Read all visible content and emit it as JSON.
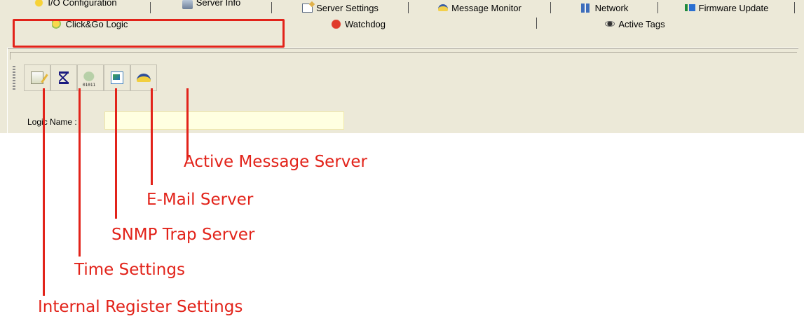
{
  "tabs_row1": [
    {
      "name": "tab-io-configuration",
      "label": "I/O Configuration",
      "icon": "io-icon"
    },
    {
      "name": "tab-server-info",
      "label": "Server Info",
      "icon": "server-icon"
    },
    {
      "name": "tab-server-settings",
      "label": "Server Settings",
      "icon": "settings-icon"
    },
    {
      "name": "tab-message-monitor",
      "label": "Message Monitor",
      "icon": "monitor-icon"
    },
    {
      "name": "tab-network",
      "label": "Network",
      "icon": "network-icon"
    },
    {
      "name": "tab-firmware-update",
      "label": "Firmware Update",
      "icon": "firmware-icon"
    }
  ],
  "tabs_row2": [
    {
      "name": "tab-clickgo-logic",
      "label": "Click&Go Logic",
      "icon": "clickgo-icon",
      "selected": true
    },
    {
      "name": "tab-watchdog",
      "label": "Watchdog",
      "icon": "watchdog-icon"
    },
    {
      "name": "tab-active-tags",
      "label": "Active Tags",
      "icon": "active-tags-icon"
    }
  ],
  "toolbar": {
    "buttons": [
      {
        "name": "internal-register-settings-button",
        "icon": "register-icon"
      },
      {
        "name": "time-settings-button",
        "icon": "hourglass-icon"
      },
      {
        "name": "snmp-trap-server-button",
        "icon": "snmp-icon"
      },
      {
        "name": "email-server-button",
        "icon": "mail-icon"
      },
      {
        "name": "active-message-server-button",
        "icon": "active-message-icon"
      }
    ]
  },
  "logic_name": {
    "label": "Logic Name :",
    "value": ""
  },
  "annotations": {
    "active_message_server": "Active Message Server",
    "email_server": "E-Mail Server",
    "snmp_trap_server": "SNMP Trap Server",
    "time_settings": "Time Settings",
    "internal_register_settings": "Internal Register Settings"
  },
  "colors": {
    "annotation": "#e2231a",
    "window_bg": "#ece9d8",
    "input_bg": "#ffffe1"
  }
}
